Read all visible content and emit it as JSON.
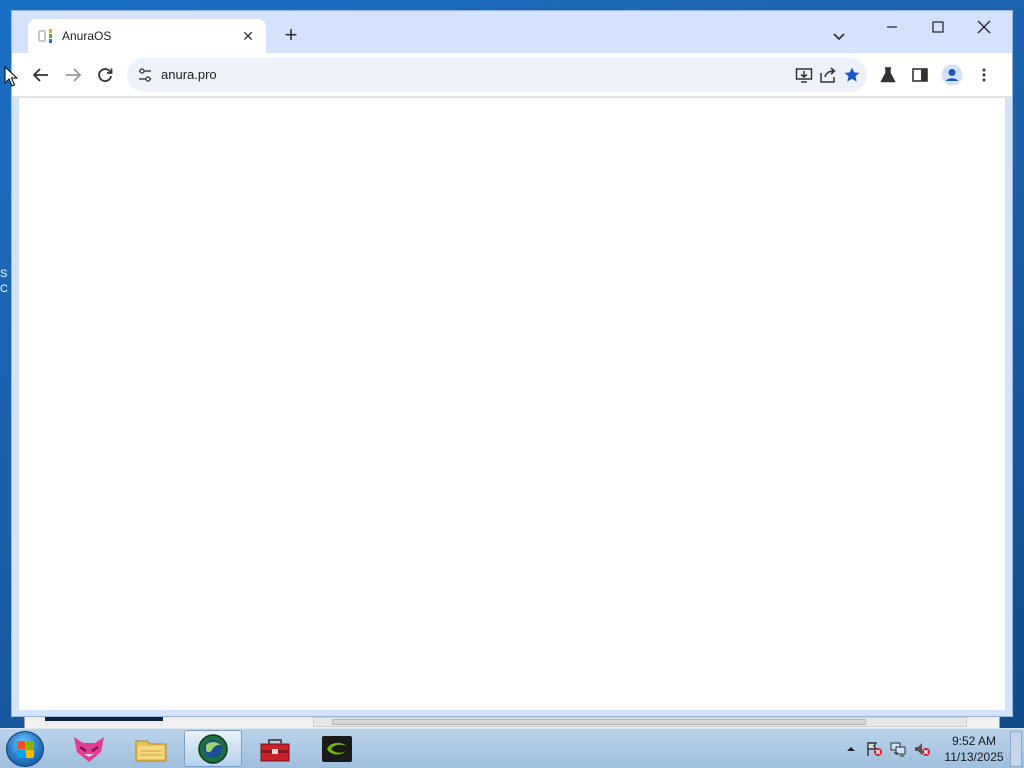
{
  "browser": {
    "tab": {
      "title": "AnuraOS",
      "close_glyph": "✕"
    },
    "new_tab_glyph": "+",
    "omnibox": {
      "url": "anura.pro"
    },
    "icons": {
      "back": "arrow-left-icon",
      "forward": "arrow-right-icon",
      "reload": "reload-icon",
      "site_info": "tune-icon",
      "install": "install-app-icon",
      "share": "share-icon",
      "bookmark": "star-icon",
      "labs": "flask-icon",
      "side_panel": "side-panel-icon",
      "profile": "profile-icon",
      "menu": "kebab-menu-icon"
    },
    "accent_color": "#1a56c4"
  },
  "taskbar": {
    "apps": [
      {
        "name": "fox-app-icon"
      },
      {
        "name": "file-explorer-icon"
      },
      {
        "name": "browser-globe-icon",
        "active": true
      },
      {
        "name": "toolbox-icon"
      },
      {
        "name": "nvidia-icon"
      }
    ],
    "clock": {
      "time": "9:52 AM",
      "date": "11/13/2025"
    }
  }
}
